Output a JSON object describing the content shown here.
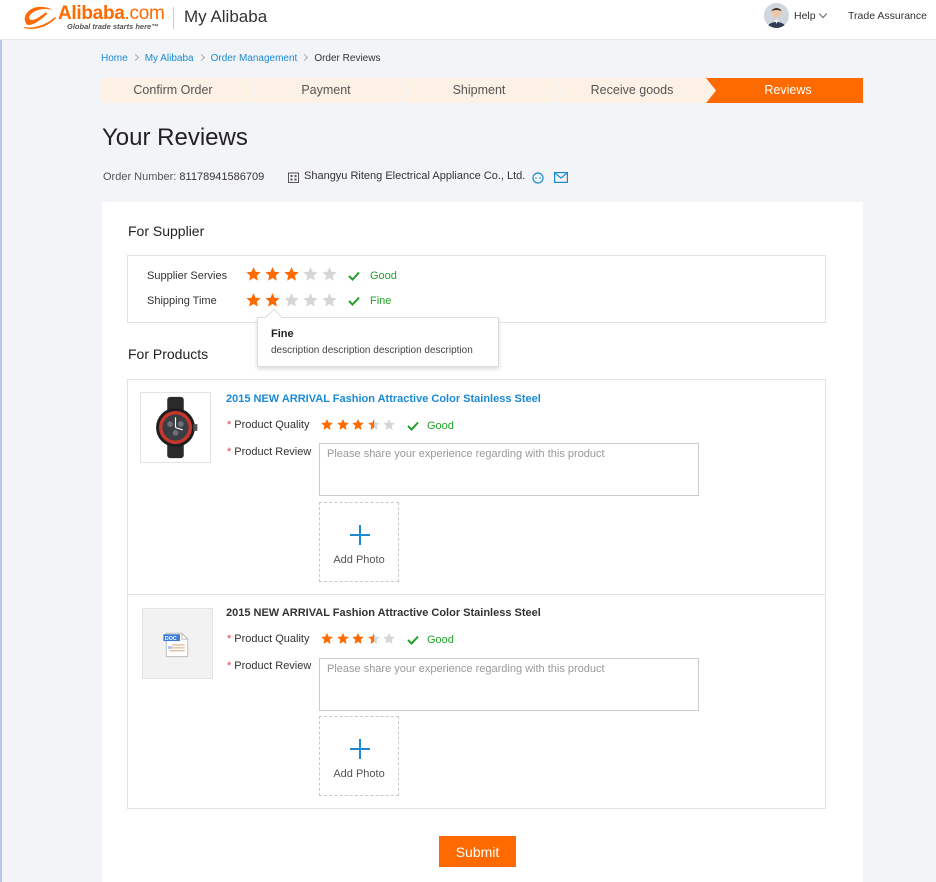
{
  "header": {
    "brand_name": "Alibaba",
    "brand_suffix": ".com",
    "brand_tagline": "Global trade starts here™",
    "app_name": "My Alibaba",
    "help_label": "Help",
    "trade_assurance_label": "Trade Assurance"
  },
  "breadcrumb": [
    "Home",
    "My Alibaba",
    "Order Management",
    "Order Reviews"
  ],
  "steps": [
    {
      "label": "Confirm Order",
      "active": false
    },
    {
      "label": "Payment",
      "active": false
    },
    {
      "label": "Shipment",
      "active": false
    },
    {
      "label": "Receive goods",
      "active": false
    },
    {
      "label": "Reviews",
      "active": true
    }
  ],
  "page_title": "Your Reviews",
  "order": {
    "number_label": "Order Number:",
    "number": "81178941586709",
    "company": "Shangyu Riteng Electrical Appliance Co., Ltd."
  },
  "supplier_section": {
    "title": "For Supplier",
    "ratings": [
      {
        "label": "Supplier Servies",
        "rating": 3,
        "max": 5,
        "word": "Good"
      },
      {
        "label": "Shipping Time",
        "rating": 2,
        "max": 5,
        "word": "Fine"
      }
    ],
    "tooltip": {
      "title": "Fine",
      "description": "description description description description"
    }
  },
  "products_section": {
    "title": "For Products",
    "quality_label": "Product Quality",
    "review_label": "Product Review",
    "review_placeholder": "Please share your experience regarding with this product",
    "add_photo_label": "Add Photo",
    "items": [
      {
        "title": "2015 NEW ARRIVAL Fashion Attractive Color Stainless Steel",
        "rating": 3.5,
        "max": 5,
        "word": "Good",
        "image": "watch"
      },
      {
        "title": "2015 NEW ARRIVAL Fashion Attractive Color Stainless Steel",
        "rating": 3.5,
        "max": 5,
        "word": "Good",
        "image": "doc-file-icon"
      }
    ]
  },
  "submit_label": "Submit",
  "colors": {
    "accent": "#ff6a00",
    "link": "#1a8ad6",
    "success": "#22a12a",
    "step_inactive": "#fdf0e4",
    "star_off": "#d6d6d6"
  }
}
